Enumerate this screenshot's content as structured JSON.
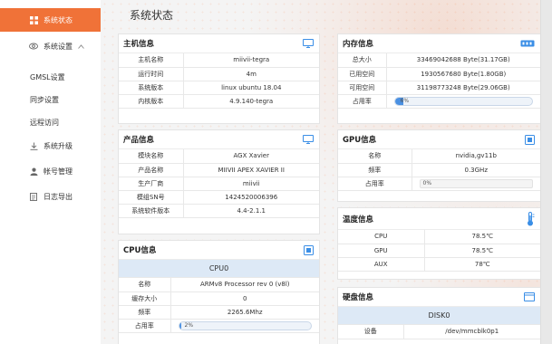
{
  "sidebar": {
    "items": [
      {
        "label": "系统状态",
        "icon": "grid-icon"
      },
      {
        "label": "系统设置",
        "icon": "eye-icon"
      },
      {
        "label": "系统升级",
        "icon": "download-icon"
      },
      {
        "label": "帐号管理",
        "icon": "user-icon"
      },
      {
        "label": "日志导出",
        "icon": "document-icon"
      }
    ],
    "subitems": [
      "GMSL设置",
      "同步设置",
      "远程访问"
    ]
  },
  "page_title": "系统状态",
  "host": {
    "title": "主机信息",
    "rows": [
      {
        "label": "主机名称",
        "value": "miivii-tegra"
      },
      {
        "label": "运行时间",
        "value": "4m"
      },
      {
        "label": "系统版本",
        "value": "linux ubuntu 18.04"
      },
      {
        "label": "内核版本",
        "value": "4.9.140-tegra"
      }
    ]
  },
  "product": {
    "title": "产品信息",
    "rows": [
      {
        "label": "模块名称",
        "value": "AGX Xavier"
      },
      {
        "label": "产品名称",
        "value": "MIIVII APEX XAVIER II"
      },
      {
        "label": "生产厂商",
        "value": "miivii"
      },
      {
        "label": "模组SN号",
        "value": "1424520006396"
      },
      {
        "label": "系统软件版本",
        "value": "4.4-2.1.1"
      }
    ]
  },
  "cpu": {
    "title": "CPU信息",
    "group": "CPU0",
    "rows": [
      {
        "label": "名称",
        "value": "ARMv8 Processor rev 0 (v8l)"
      },
      {
        "label": "缓存大小",
        "value": "0"
      },
      {
        "label": "频率",
        "value": "2265.6Mhz"
      }
    ],
    "usage_label": "占用率",
    "usage_text": "2%",
    "usage": 0.02
  },
  "memory": {
    "title": "内存信息",
    "rows": [
      {
        "label": "总大小",
        "value": "33469042688 Byte(31.17GB)"
      },
      {
        "label": "已用空间",
        "value": "1930567680 Byte(1.80GB)"
      },
      {
        "label": "可用空间",
        "value": "31198773248 Byte(29.06GB)"
      }
    ],
    "usage_label": "占用率",
    "usage_text": "6%",
    "usage": 0.06
  },
  "gpu": {
    "title": "GPU信息",
    "rows": [
      {
        "label": "名称",
        "value": "nvidia,gv11b"
      },
      {
        "label": "频率",
        "value": "0.3GHz"
      }
    ],
    "usage_label": "占用率",
    "usage_text": "0%",
    "usage": 0
  },
  "temperature": {
    "title": "温度信息",
    "rows": [
      {
        "label": "CPU",
        "value": "78.5℃"
      },
      {
        "label": "GPU",
        "value": "78.5℃"
      },
      {
        "label": "AUX",
        "value": "78℃"
      }
    ]
  },
  "disk": {
    "title": "硬盘信息",
    "group": "DISK0",
    "rows": [
      {
        "label": "设备",
        "value": "/dev/mmcblk0p1"
      }
    ]
  },
  "colors": {
    "accent": "#f07238",
    "progress": "#4a90e2",
    "icon_blue": "#3a8ee6"
  }
}
